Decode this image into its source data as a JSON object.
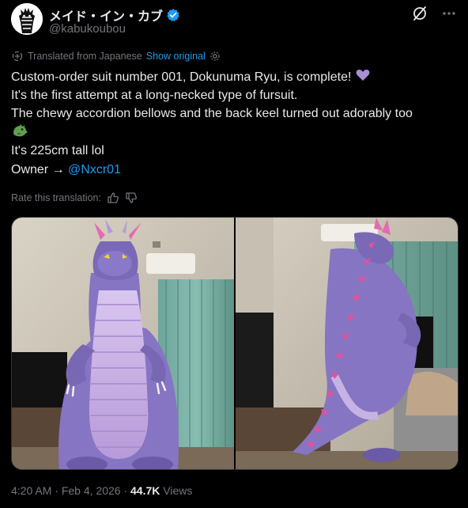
{
  "author": {
    "display_name": "メイド・イン・カブ",
    "handle": "@kabukoubou",
    "verified_icon": "verified-badge-icon",
    "avatar_icon": "zebra-avatar"
  },
  "header_actions": [
    "grok-icon",
    "more-icon"
  ],
  "translation": {
    "label": "Translated from Japanese",
    "show_original": "Show original",
    "rate_label": "Rate this translation:"
  },
  "tweet": {
    "line1": "Custom-order suit number 001, Dokunuma Ryu, is complete!",
    "line2": "It's the first attempt at a long-necked type of fursuit.",
    "line3": "The chewy accordion bellows and the back keel turned out adorably too",
    "line4": "It's 225cm tall lol",
    "owner_prefix": "Owner → ",
    "owner_mention": "@Nxcr01"
  },
  "footer": {
    "time": "4:20 AM",
    "sep": " · ",
    "date": "Feb 4, 2026",
    "views_count": "44.7K",
    "views_label": "Views"
  },
  "colors": {
    "accent": "#1d9bf0",
    "text": "#e7e9ea",
    "muted": "#71767b",
    "suit_purple": "#8e7dc8",
    "belly_lilac": "#cbb3e8",
    "spike_pink": "#e0529b"
  }
}
